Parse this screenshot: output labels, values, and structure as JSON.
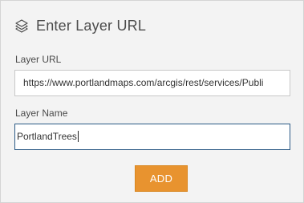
{
  "header": {
    "icon": "layers-icon",
    "title": "Enter Layer URL"
  },
  "form": {
    "url_label": "Layer URL",
    "url_value": "https://www.portlandmaps.com/arcgis/rest/services/Publi",
    "name_label": "Layer Name",
    "name_value": "PortlandTrees"
  },
  "actions": {
    "add_label": "ADD"
  },
  "colors": {
    "accent": "#e8932f",
    "panel_bg": "#f3f3f3",
    "focus_border": "#2b5a86"
  }
}
